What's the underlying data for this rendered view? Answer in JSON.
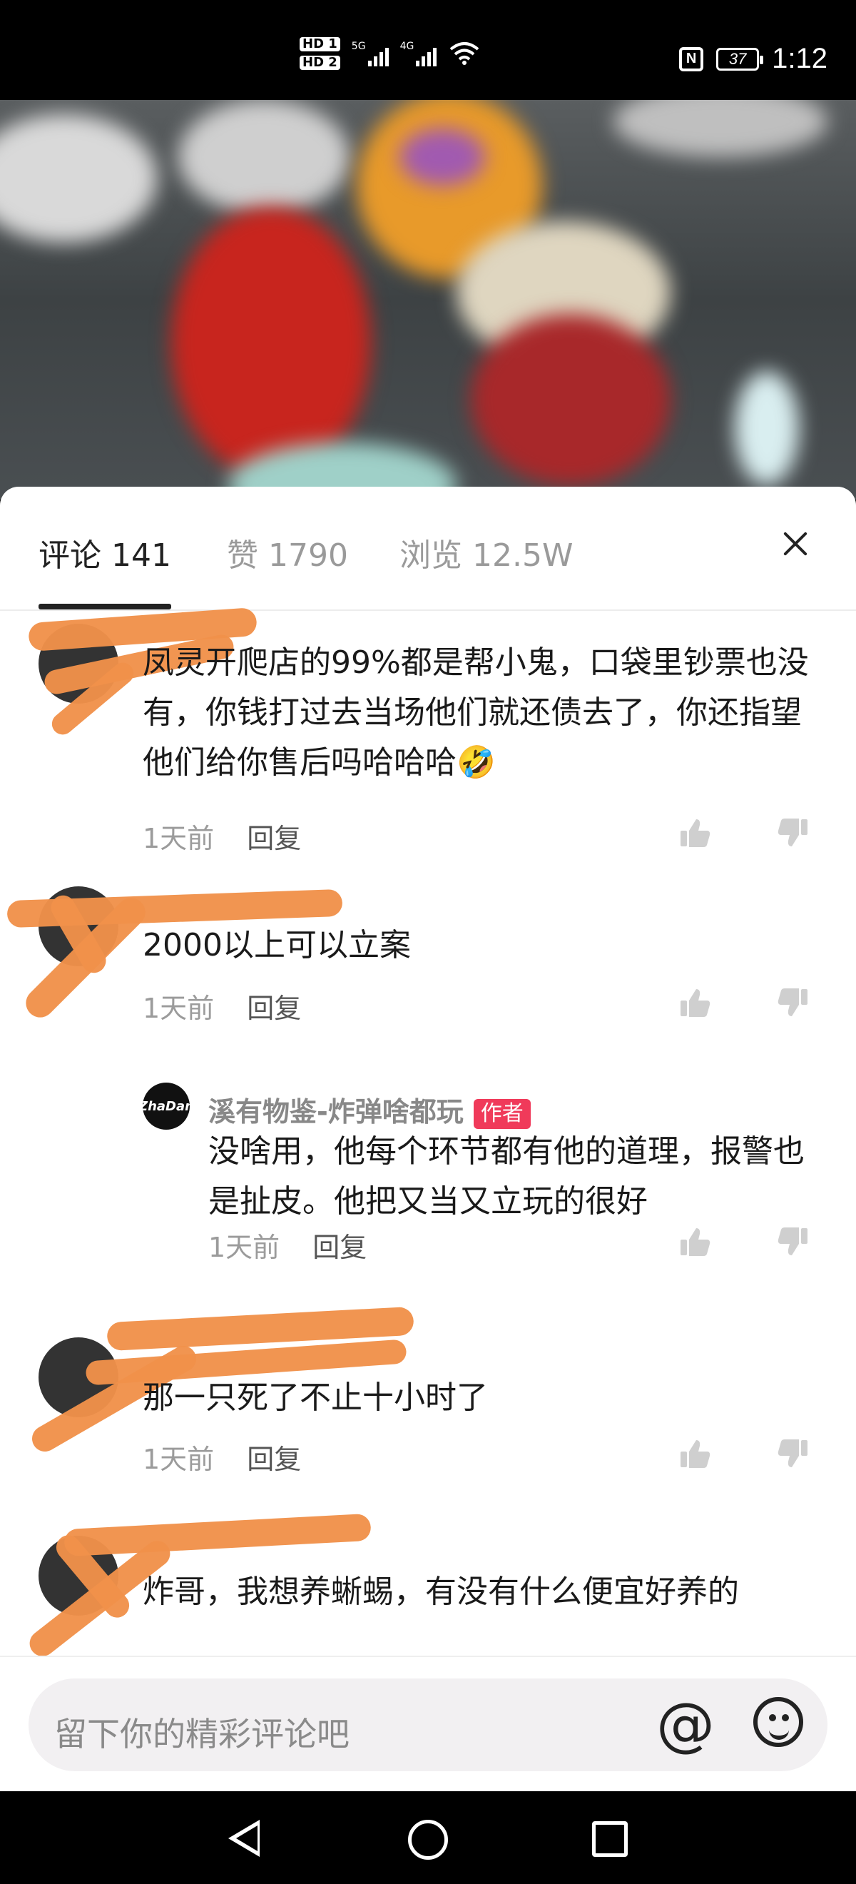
{
  "status_bar": {
    "hd1": "HD 1",
    "hd2": "HD 2",
    "net1": "5G",
    "net2": "4G",
    "wifi": "6",
    "nfc": "N",
    "battery": "37",
    "time": "1:12"
  },
  "tabs": [
    {
      "label": "评论 141",
      "active": true
    },
    {
      "label": "赞 1790",
      "active": false
    },
    {
      "label": "浏览 12.5W",
      "active": false
    }
  ],
  "comments": [
    {
      "body": "凤灵开爬店的99%都是帮小鬼，口袋里钞票也没有，你钱打过去当场他们就还债去了，你还指望他们给你售后吗哈哈哈🤣",
      "time": "1天前",
      "reply": "回复"
    },
    {
      "body": "2000以上可以立案",
      "time": "1天前",
      "reply": "回复",
      "replies": [
        {
          "avatar_text": "ZhaDan",
          "name": "溪有物鉴-炸弹啥都玩",
          "badge": "作者",
          "body": "没啥用，他每个环节都有他的道理，报警也是扯皮。他把又当又立玩的很好",
          "time": "1天前",
          "reply": "回复"
        }
      ]
    },
    {
      "body": "那一只死了不止十小时了",
      "time": "1天前",
      "reply": "回复"
    },
    {
      "body": "炸哥，我想养蜥蜴，有没有什么便宜好养的",
      "time": "",
      "reply": ""
    }
  ],
  "input": {
    "placeholder": "留下你的精彩评论吧"
  },
  "icons": {
    "mention": "@",
    "emoji": "emoji-icon",
    "close": "close-icon",
    "like": "thumbs-up-icon",
    "dislike": "thumbs-down-icon"
  },
  "colors": {
    "badge": "#f03a5a",
    "scribble": "#f0914a"
  }
}
